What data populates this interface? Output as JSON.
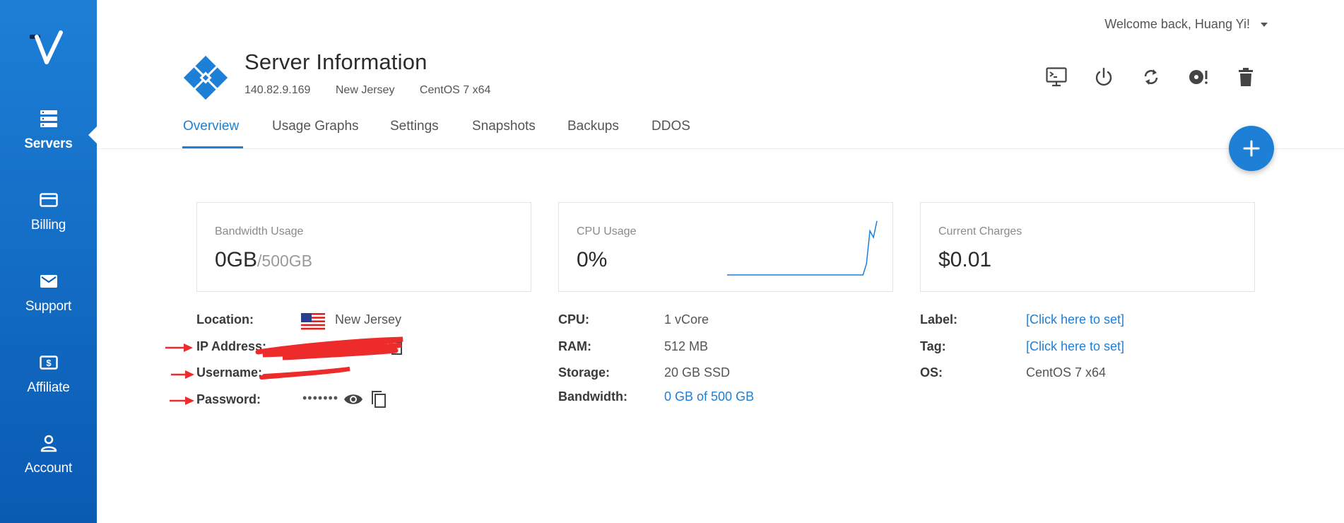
{
  "sidebar": {
    "items": [
      {
        "label": "Servers",
        "icon": "servers-icon",
        "active": true
      },
      {
        "label": "Billing",
        "icon": "credit-card-icon"
      },
      {
        "label": "Support",
        "icon": "envelope-icon"
      },
      {
        "label": "Affiliate",
        "icon": "dollar-icon"
      },
      {
        "label": "Account",
        "icon": "user-icon"
      }
    ]
  },
  "header": {
    "welcome": "Welcome back, Huang Yi!",
    "title": "Server Information",
    "ip": "140.82.9.169",
    "location": "New Jersey",
    "os": "CentOS 7 x64"
  },
  "toolbar": {
    "icons": [
      "console-icon",
      "power-icon",
      "restart-icon",
      "iso-icon",
      "trash-icon"
    ]
  },
  "tabs": [
    "Overview",
    "Usage Graphs",
    "Settings",
    "Snapshots",
    "Backups",
    "DDOS"
  ],
  "active_tab": "Overview",
  "cards": {
    "bandwidth": {
      "title": "Bandwidth Usage",
      "used": "0GB",
      "total": "/500GB"
    },
    "cpu": {
      "title": "CPU Usage",
      "value": "0%"
    },
    "charges": {
      "title": "Current Charges",
      "value": "$0.01"
    }
  },
  "cpu_sparkline": {
    "values": [
      0,
      0,
      0,
      0,
      0,
      0,
      0,
      0,
      0,
      0,
      0,
      0,
      0,
      0,
      0,
      0,
      0,
      0,
      0,
      0,
      0,
      0,
      0,
      0,
      0,
      0,
      0,
      0,
      0,
      0,
      0,
      0,
      0,
      0,
      0,
      0,
      0,
      0,
      0,
      0,
      0.2,
      0.8,
      0.68,
      0.98
    ]
  },
  "details_left": {
    "location_label": "Location:",
    "location_value": "New Jersey",
    "ip_label": "IP Address:",
    "username_label": "Username:",
    "password_label": "Password:",
    "password_mask": "•••••••"
  },
  "details_mid": {
    "cpu_label": "CPU:",
    "cpu_value": "1 vCore",
    "ram_label": "RAM:",
    "ram_value": "512 MB",
    "storage_label": "Storage:",
    "storage_value": "20 GB SSD",
    "bandwidth_label": "Bandwidth:",
    "bandwidth_value": "0 GB of 500 GB"
  },
  "details_right": {
    "label_label": "Label:",
    "label_value": "[Click here to set]",
    "tag_label": "Tag:",
    "tag_value": "[Click here to set]",
    "os_label": "OS:",
    "os_value": "CentOS 7 x64"
  },
  "colors": {
    "accent": "#1d7fd6",
    "redaction": "#ee2b2b"
  }
}
